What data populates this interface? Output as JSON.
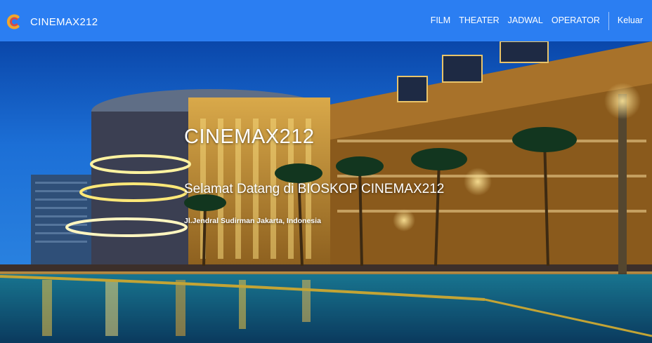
{
  "brand": {
    "name": "CINEMAX212"
  },
  "nav": {
    "items": [
      {
        "label": "FILM"
      },
      {
        "label": "THEATER"
      },
      {
        "label": "JADWAL"
      },
      {
        "label": "OPERATOR"
      }
    ],
    "logout_label": "Keluar"
  },
  "hero": {
    "title": "CINEMAX212",
    "subtitle": "Selamat Datang di BIOSKOP CINEMAX212",
    "address": "Jl.Jendral Sudirman Jakarta, Indonesia",
    "background": "night-mall-photo"
  },
  "colors": {
    "navbar": "#2b7ef2",
    "text": "#ffffff"
  }
}
